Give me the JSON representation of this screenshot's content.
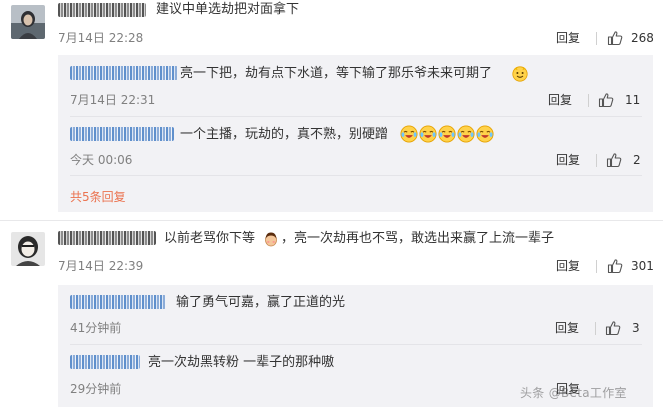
{
  "comments": [
    {
      "text": "建议中单选劫把对面拿下",
      "time": "7月14日 22:28",
      "reply_label": "回复",
      "likes": "268",
      "sub_replies": [
        {
          "text": "亮一下把，劫有点下水道，等下输了那乐爷未来可期了",
          "time": "7月14日 22:31",
          "reply_label": "回复",
          "likes": "11"
        },
        {
          "text": "一个主播，玩劫的，真不熟，别硬蹭",
          "time": "今天 00:06",
          "reply_label": "回复",
          "likes": "2"
        }
      ],
      "more_replies": "共5条回复"
    },
    {
      "text_before": "以前老骂你下等",
      "text_after": "，亮一次劫再也不骂，敢选出来赢了上流一辈子",
      "time": "7月14日 22:39",
      "reply_label": "回复",
      "likes": "301",
      "sub_replies": [
        {
          "text": "输了勇气可嘉，赢了正道的光",
          "time": "41分钟前",
          "reply_label": "回复",
          "likes": "3"
        },
        {
          "text": "亮一次劫黑转粉 一辈子的那种嗷",
          "time": "29分钟前",
          "reply_label": "回复"
        }
      ]
    }
  ],
  "watermark": "头条 @Beta工作室",
  "colors": {
    "accent": "#eb7350",
    "muted": "#808080",
    "sub_bg": "#f2f2f5"
  },
  "icons": {
    "like": "thumb-up-icon",
    "emoji_smile": "smile-emoji",
    "emoji_laugh": "laugh-cry-emoji",
    "emoji_shy": "shy-emoji"
  }
}
